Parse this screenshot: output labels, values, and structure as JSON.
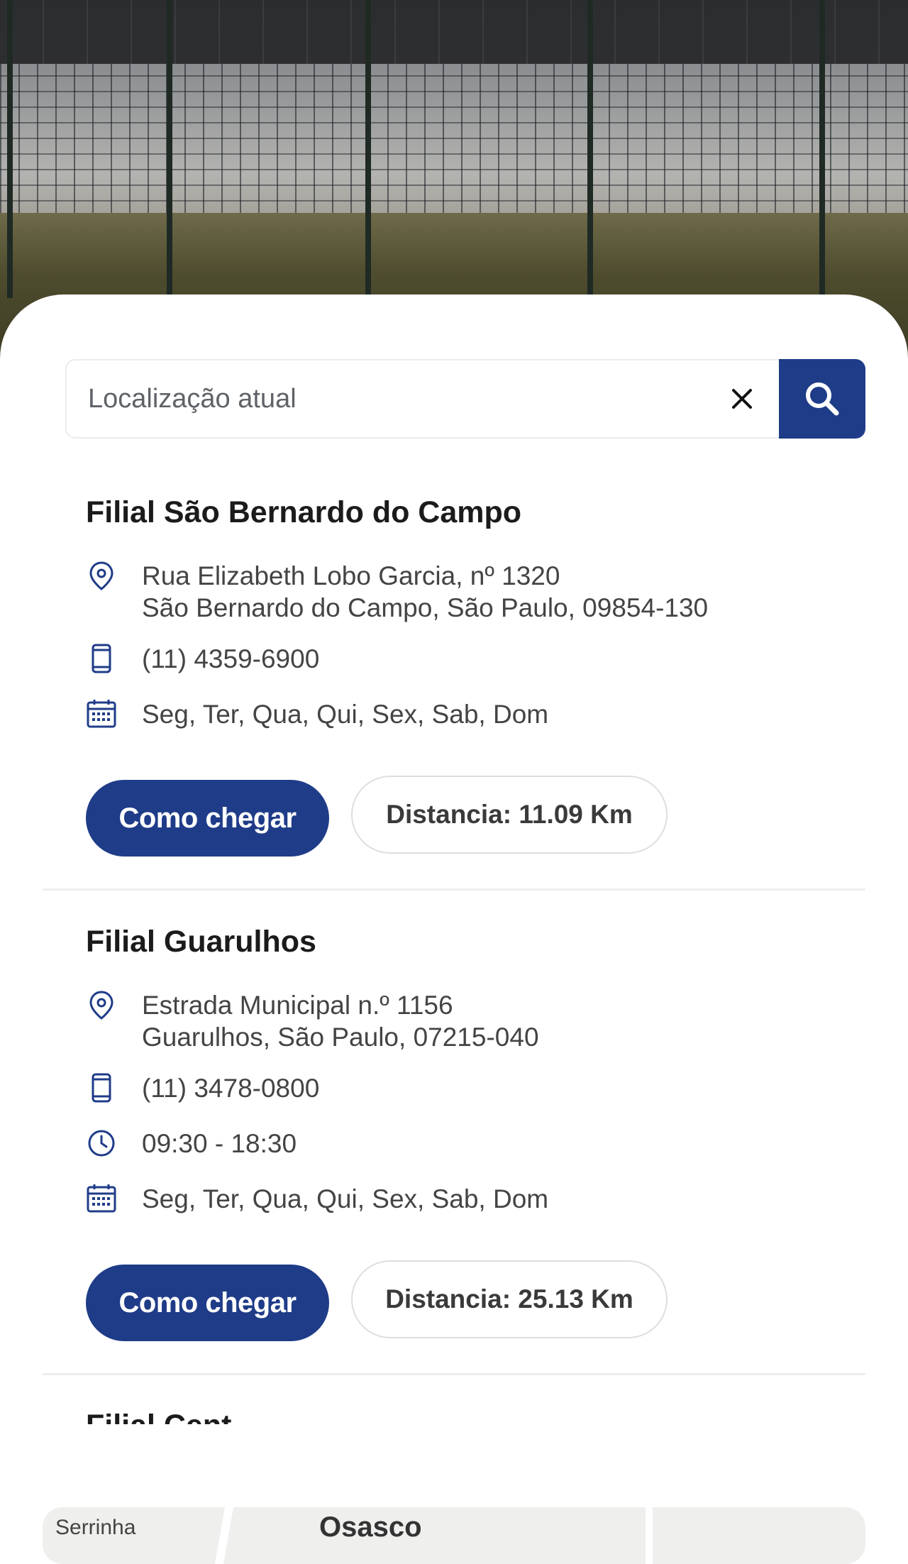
{
  "search": {
    "placeholder": "Localização atual"
  },
  "branches": [
    {
      "name": "Filial São Bernardo do Campo",
      "address_line1": "Rua Elizabeth Lobo Garcia, nº 1320",
      "address_line2": "São Bernardo do Campo, São Paulo, 09854-130",
      "phone": "(11) 4359-6900",
      "days": "Seg, Ter, Qua, Qui, Sex, Sab, Dom",
      "directions_label": "Como chegar",
      "distance": "Distancia: 11.09 Km"
    },
    {
      "name": "Filial Guarulhos",
      "address_line1": "Estrada Municipal n.º 1156",
      "address_line2": "Guarulhos, São Paulo, 07215-040",
      "phone": "(11) 3478-0800",
      "hours": "09:30 - 18:30",
      "days": "Seg, Ter, Qua, Qui, Sex, Sab, Dom",
      "directions_label": "Como chegar",
      "distance": "Distancia: 25.13 Km"
    }
  ],
  "next_branch_partial": "Filial Cent",
  "map": {
    "label_left": "Serrinha",
    "label_center": "Osasco"
  },
  "colors": {
    "primary": "#1f3c88",
    "text": "#1b1b1b",
    "muted": "#444444"
  }
}
